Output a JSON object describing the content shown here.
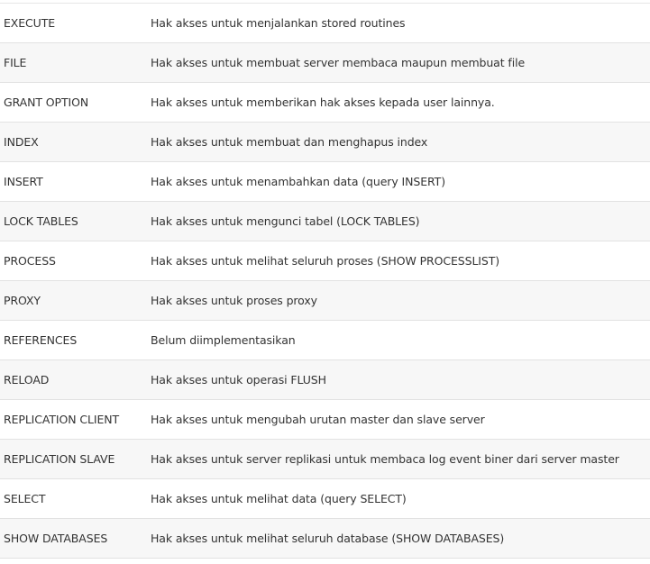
{
  "privileges": [
    {
      "name": "EXECUTE",
      "description": "Hak akses untuk menjalankan stored routines"
    },
    {
      "name": "FILE",
      "description": "Hak akses untuk membuat server membaca maupun membuat file"
    },
    {
      "name": "GRANT OPTION",
      "description": "Hak akses untuk memberikan hak akses kepada user lainnya."
    },
    {
      "name": "INDEX",
      "description": "Hak akses untuk membuat dan menghapus index"
    },
    {
      "name": "INSERT",
      "description": "Hak akses untuk menambahkan data (query INSERT)"
    },
    {
      "name": "LOCK TABLES",
      "description": "Hak akses untuk mengunci tabel (LOCK TABLES)"
    },
    {
      "name": "PROCESS",
      "description": "Hak akses untuk melihat seluruh proses (SHOW PROCESSLIST)"
    },
    {
      "name": "PROXY",
      "description": "Hak akses untuk proses proxy"
    },
    {
      "name": "REFERENCES",
      "description": "Belum diimplementasikan"
    },
    {
      "name": "RELOAD",
      "description": "Hak akses untuk operasi FLUSH"
    },
    {
      "name": "REPLICATION CLIENT",
      "description": "Hak akses untuk mengubah urutan master dan slave server"
    },
    {
      "name": "REPLICATION SLAVE",
      "description": "Hak akses untuk server replikasi untuk membaca log event biner dari server master"
    },
    {
      "name": "SELECT",
      "description": "Hak akses untuk melihat data (query SELECT)"
    },
    {
      "name": "SHOW DATABASES",
      "description": "Hak akses untuk melihat seluruh database (SHOW DATABASES)"
    }
  ]
}
